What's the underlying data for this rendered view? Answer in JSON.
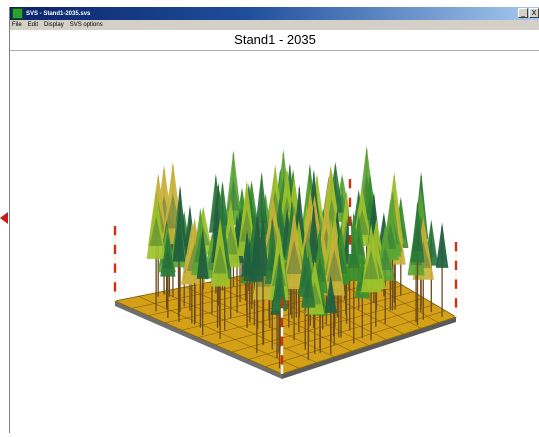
{
  "window": {
    "title": "SVS - Stand1-2035.svs",
    "controls": [
      "_",
      "X"
    ]
  },
  "menu": [
    "File",
    "Edit",
    "Display",
    "SVS options"
  ],
  "view": {
    "title": "Stand1 - 2035"
  },
  "colors": {
    "titlebar": "#0a246a",
    "ground": "#d4a017",
    "grid_line": "#7a5400",
    "trunk": "#6b4a1e",
    "crown_dark": "#1f5f3f",
    "crown_mid": "#3a8f2f",
    "crown_light": "#9cc22b",
    "marker_red": "#d03010",
    "arrow": "#c61b1b"
  }
}
